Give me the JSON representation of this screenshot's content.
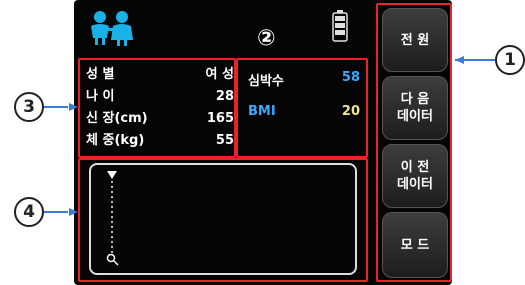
{
  "callouts": {
    "c1": "①",
    "c2": "②",
    "c3": "③",
    "c4": "④",
    "c1_label": "1",
    "c2_label": "2",
    "c3_label": "3",
    "c4_label": "4"
  },
  "patient_info": {
    "gender_label": "성 별",
    "gender_value": "여 성",
    "age_label": "나 이",
    "age_value": "28",
    "height_label": "신 장(cm)",
    "height_value": "165",
    "weight_label": "체 중(kg)",
    "weight_value": "55"
  },
  "vitals": {
    "heart_rate_label": "심박수",
    "heart_rate_value": "58",
    "bmi_label": "BMI",
    "bmi_value": "20"
  },
  "side_buttons": {
    "power": "전 원",
    "next_line1": "다 음",
    "next_line2": "데이터",
    "prev_line1": "이 전",
    "prev_line2": "데이터",
    "mode": "모 드"
  },
  "icons": {
    "logo": "couple-icon",
    "battery": "battery-icon",
    "graph_top": "triangle-down-icon",
    "graph_bottom": "magnifier-icon"
  },
  "colors": {
    "screen_bg": "#050505",
    "highlight_box": "#e8242a",
    "heart_rate_value": "#3aa8ff",
    "bmi_label": "#3aa8ff",
    "bmi_value": "#f0e68c",
    "logo": "#1ab0e8",
    "callout_line": "#3a7bd5"
  }
}
